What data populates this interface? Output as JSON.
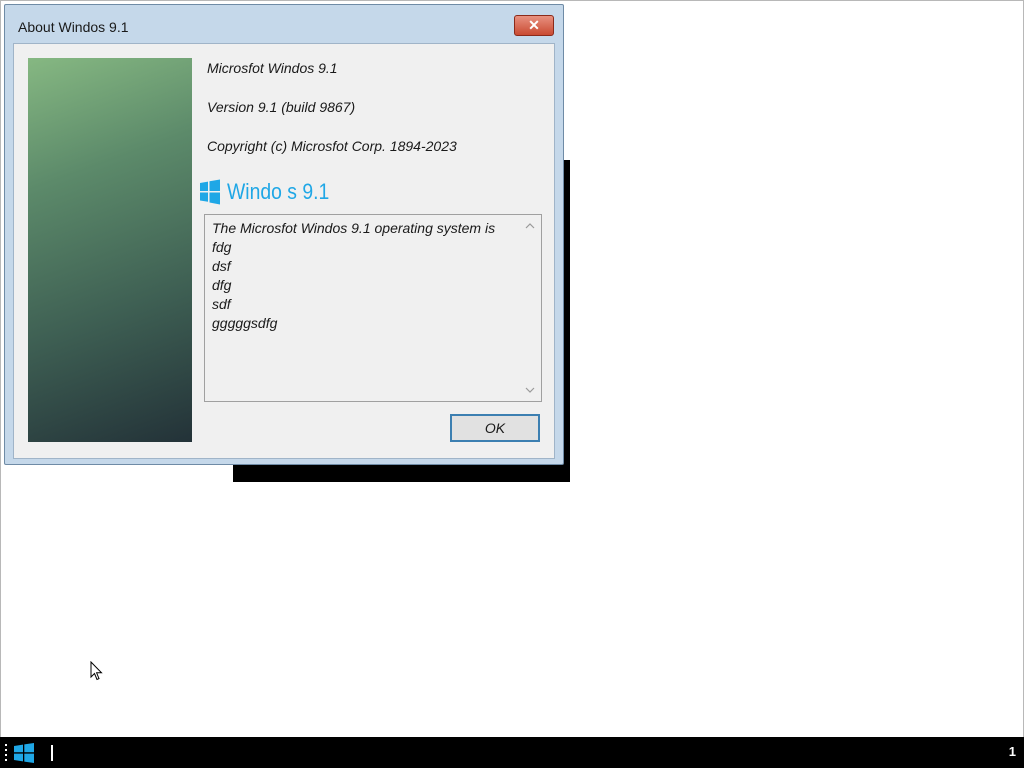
{
  "dialog": {
    "title": "About Windos 9.1",
    "close_label": "✕",
    "product_name": "Microsfot Windos 9.1",
    "version": "Version 9.1 (build 9867)",
    "copyright": "Copyright (c) Microsfot Corp. 1894-2023",
    "logo_text": "Windo  s 9.1",
    "license_lines": [
      "The Microsfot Windos 9.1 operating system is",
      "fdg",
      "dsf",
      "dfg",
      "sdf",
      "gggggsdfg"
    ],
    "ok_label": "OK"
  },
  "colors": {
    "accent": "#1fa7e6",
    "close_button": "#c94a32",
    "taskbar": "#000000",
    "button_border": "#3c7fb1"
  },
  "taskbar": {
    "tray_text": "1"
  }
}
